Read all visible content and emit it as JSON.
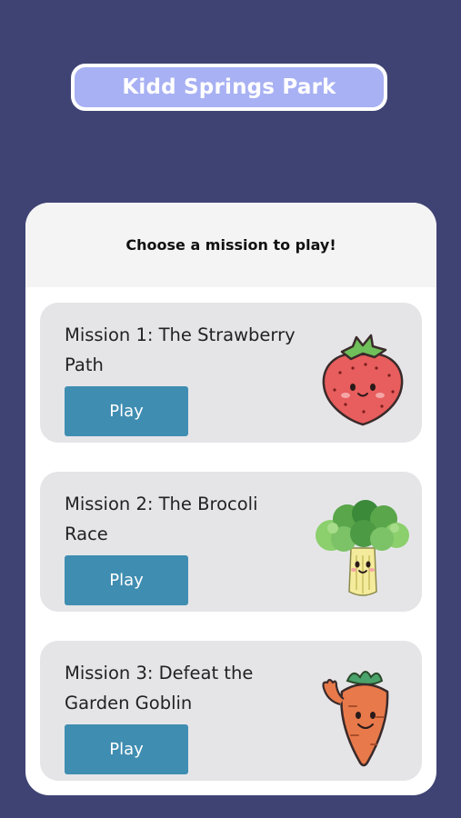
{
  "park": {
    "title": "Kidd Springs Park"
  },
  "panel": {
    "heading": "Choose a mission to play!"
  },
  "missions": [
    {
      "title": "Mission 1: The Strawberry Path",
      "button_label": "Play",
      "icon": "strawberry-icon"
    },
    {
      "title": "Mission 2: The Brocoli Race",
      "button_label": "Play",
      "icon": "broccoli-icon"
    },
    {
      "title": "Mission 3: Defeat the Garden Goblin",
      "button_label": "Play",
      "icon": "carrot-icon"
    }
  ],
  "colors": {
    "background": "#3f4373",
    "title_pill": "#a8b1f3",
    "card": "#e5e5e8",
    "play_button": "#3f8db1"
  }
}
